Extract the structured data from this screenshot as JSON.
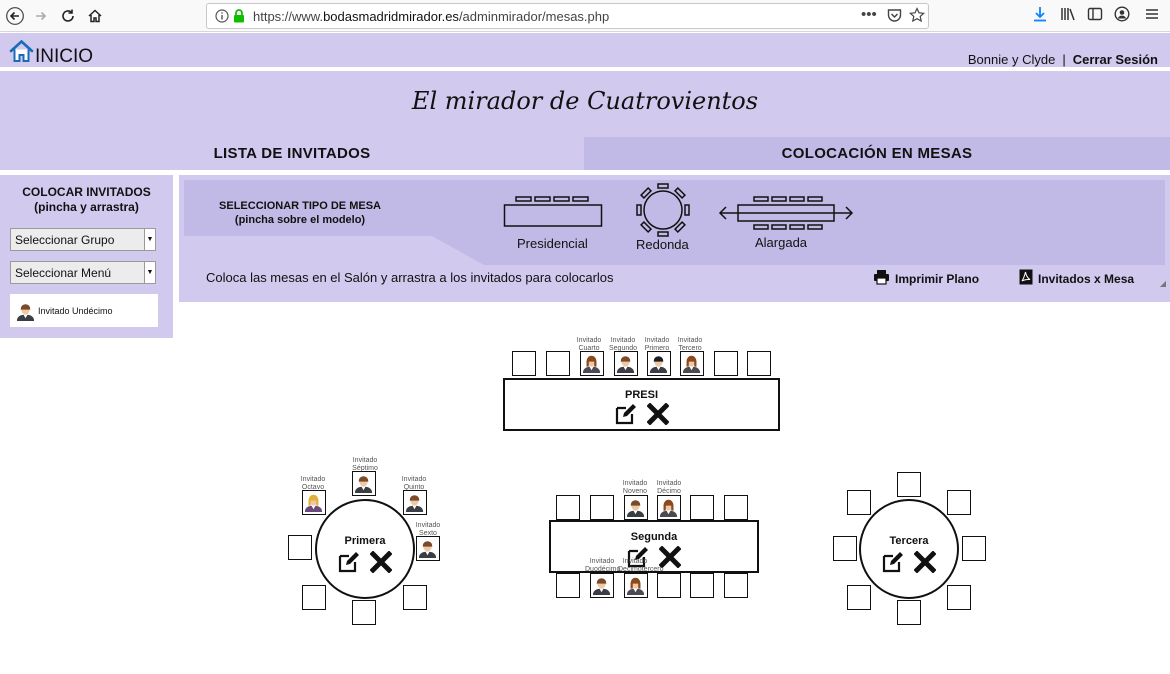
{
  "browser": {
    "url_prefix": "https://www.",
    "url_domain": "bodasmadridmirador.es",
    "url_path": "/adminmirador/mesas.php"
  },
  "header": {
    "home_label": "INICIO",
    "user_name": "Bonnie y Clyde",
    "separator": "|",
    "logout_label": "Cerrar Sesión",
    "site_title": "El mirador de Cuatrovientos"
  },
  "tabs": {
    "guests_label": "LISTA DE INVITADOS",
    "tables_label": "COLOCACIÓN EN MESAS"
  },
  "left_panel": {
    "title_line1": "COLOCAR INVITADOS",
    "title_line2": "(pincha y arrastra)",
    "group_select": "Seleccionar Grupo",
    "menu_select": "Seleccionar Menú",
    "guest": "Invitado Undécimo"
  },
  "type_panel": {
    "title_line1": "SELECCIONAR TIPO DE MESA",
    "title_line2": "(pincha sobre el modelo)",
    "type_presidencial": "Presidencial",
    "type_redonda": "Redonda",
    "type_alargada": "Alargada",
    "hint": "Coloca las mesas en el Salón y arrastra a los invitados para colocarlos",
    "print_label": "Imprimir Plano",
    "export_label": "Invitados x Mesa"
  },
  "tables": {
    "presi": {
      "name": "PRESI",
      "guest_cuarto": "Invitado Cuarto",
      "guest_segundo": "Invitado Segundo",
      "guest_primero": "Invitado Primero",
      "guest_tercero": "Invitado Tercero"
    },
    "primera": {
      "name": "Primera",
      "guest_septimo": "Invitado Séptimo",
      "guest_octavo": "Invitado Octavo",
      "guest_quinto": "Invitado Quinto",
      "guest_sexto": "Invitado Sexto"
    },
    "segunda": {
      "name": "Segunda",
      "guest_noveno": "Invitado Noveno",
      "guest_decimo": "Invitado Décimo",
      "guest_duodecimo": "Invitado Duodécimo",
      "guest_decimotercero": "Invitado Decimotercero"
    },
    "tercera": {
      "name": "Tercera"
    }
  },
  "colors": {
    "lavender": "#d1c9ee",
    "lavender_dark": "#c2bae6",
    "text": "#111111"
  },
  "icons": [
    "back-icon",
    "forward-icon",
    "reload-icon",
    "home-icon",
    "lock-icon",
    "edit-icon",
    "delete-icon",
    "printer-icon",
    "pdf-icon",
    "person-avatar-icon"
  ]
}
